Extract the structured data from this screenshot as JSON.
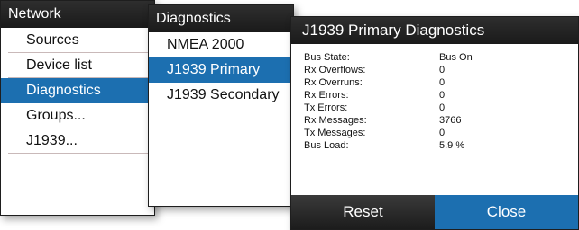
{
  "network_menu": {
    "title": "Network",
    "items": [
      "Sources",
      "Device list",
      "Diagnostics",
      "Groups...",
      "J1939..."
    ],
    "selected": "Diagnostics"
  },
  "diagnostics_menu": {
    "title": "Diagnostics",
    "items": [
      "NMEA 2000",
      "J1939 Primary",
      "J1939 Secondary"
    ],
    "selected": "J1939 Primary"
  },
  "dialog": {
    "title": "J1939 Primary Diagnostics",
    "rows": [
      {
        "label": "Bus State:",
        "value": "Bus On"
      },
      {
        "label": "Rx Overflows:",
        "value": "0"
      },
      {
        "label": "Rx Overruns:",
        "value": "0"
      },
      {
        "label": "Rx Errors:",
        "value": "0"
      },
      {
        "label": "Tx Errors:",
        "value": "0"
      },
      {
        "label": "Rx Messages:",
        "value": "3766"
      },
      {
        "label": "Tx Messages:",
        "value": "0"
      },
      {
        "label": "Bus Load:",
        "value": "5.9 %"
      }
    ],
    "buttons": {
      "reset": "Reset",
      "close": "Close"
    }
  },
  "colors": {
    "header_bg": "#1a1a1a",
    "selected_bg": "#1c6fb0",
    "separator": "#c9b9b9"
  }
}
